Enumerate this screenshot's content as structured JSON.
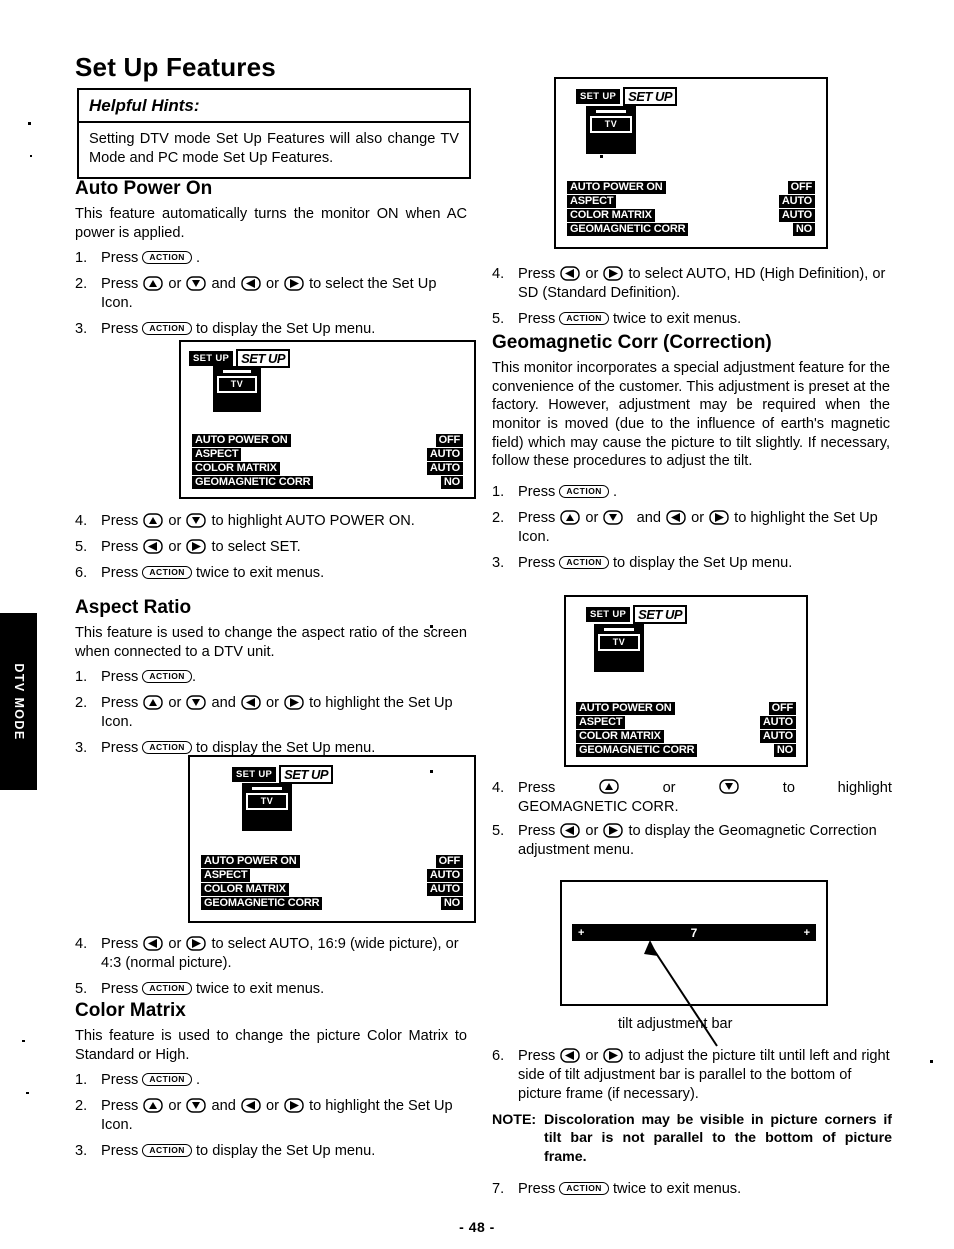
{
  "page": {
    "title": "Set Up Features",
    "number": "- 48 -",
    "side_tab": "DTV MODE"
  },
  "hints": {
    "title": "Helpful Hints:",
    "text": "Setting DTV mode Set Up Features will also change TV Mode and PC mode Set Up Features."
  },
  "keys": {
    "action": "ACTION",
    "up": "up-arrow-key",
    "down": "down-arrow-key",
    "left": "left-arrow-key",
    "right": "right-arrow-key"
  },
  "osd": {
    "setup_small": "SET UP",
    "setup_big": "SET UP",
    "tv": "TV",
    "rows": [
      {
        "label": "AUTO POWER ON",
        "value": "OFF"
      },
      {
        "label": "ASPECT",
        "value": "AUTO"
      },
      {
        "label": "COLOR MATRIX",
        "value": "AUTO"
      },
      {
        "label": "GEOMAGNETIC CORR",
        "value": "NO"
      }
    ]
  },
  "tilt": {
    "minus": "+",
    "value": "7",
    "plus": "+",
    "caption": "tilt adjustment bar"
  },
  "sections": [
    {
      "id": "auto-power-on",
      "heading": "Auto Power On",
      "intro": "This feature automatically turns the monitor ON when AC power is applied.",
      "steps": [
        {
          "num": "1.",
          "parts": [
            "Press ",
            "[ACTION]",
            " ."
          ]
        },
        {
          "num": "2.",
          "parts": [
            "Press ",
            "[UP]",
            " or ",
            "[DOWN]",
            " and ",
            "[LEFT]",
            " or ",
            "[RIGHT]",
            " to select the Set Up Icon."
          ]
        },
        {
          "num": "3.",
          "parts": [
            "Press ",
            "[ACTION]",
            " to display the Set Up menu."
          ]
        },
        {
          "num": "4.",
          "parts": [
            "Press ",
            "[UP]",
            " or ",
            "[DOWN]",
            " to highlight AUTO POWER ON."
          ]
        },
        {
          "num": "5.",
          "parts": [
            "Press ",
            "[LEFT]",
            " or ",
            "[RIGHT]",
            " to select SET."
          ]
        },
        {
          "num": "6.",
          "parts": [
            "Press ",
            "[ACTION]",
            " twice to exit menus."
          ]
        }
      ]
    },
    {
      "id": "aspect-ratio",
      "heading": "Aspect Ratio",
      "intro": "This feature is used to change the aspect ratio of the screen when connected to a DTV unit.",
      "steps": [
        {
          "num": "1.",
          "parts": [
            "Press ",
            "[ACTION]",
            "."
          ]
        },
        {
          "num": "2.",
          "parts": [
            "Press ",
            "[UP]",
            " or ",
            "[DOWN]",
            " and ",
            "[LEFT]",
            " or ",
            "[RIGHT]",
            " to highlight the Set Up Icon."
          ]
        },
        {
          "num": "3.",
          "parts": [
            "Press ",
            "[ACTION]",
            " to display the Set Up menu."
          ]
        },
        {
          "num": "4.",
          "parts": [
            "Press ",
            "[LEFT]",
            " or ",
            "[RIGHT]",
            " to select AUTO, 16:9 (wide picture), or 4:3 (normal picture)."
          ]
        },
        {
          "num": "5.",
          "parts": [
            "Press ",
            "[ACTION]",
            " twice to exit menus."
          ]
        }
      ]
    },
    {
      "id": "color-matrix",
      "heading": "Color Matrix",
      "intro": "This feature is used to change the picture Color Matrix to Standard or High.",
      "steps": [
        {
          "num": "1.",
          "parts": [
            "Press ",
            "[ACTION]",
            " ."
          ]
        },
        {
          "num": "2.",
          "parts": [
            "Press ",
            "[UP]",
            " or ",
            "[DOWN]",
            " and ",
            "[LEFT]",
            " or ",
            "[RIGHT]",
            " to highlight the Set Up Icon."
          ]
        },
        {
          "num": "3.",
          "parts": [
            "Press ",
            "[ACTION]",
            " to display the Set Up menu."
          ]
        },
        {
          "num": "4.",
          "parts": [
            "Press ",
            "[LEFT]",
            " or ",
            "[RIGHT]",
            " to select AUTO, HD (High Definition), or SD (Standard Definition)."
          ]
        },
        {
          "num": "5.",
          "parts": [
            "Press ",
            "[ACTION]",
            " twice to exit menus."
          ]
        }
      ]
    },
    {
      "id": "geomagnetic-corr",
      "heading": "Geomagnetic Corr (Correction)",
      "intro": "This monitor incorporates a special adjustment feature for the convenience of the customer. This adjustment is preset at the factory. However, adjustment may be required when the monitor is moved (due to the influence of earth's magnetic field) which may cause the picture to tilt slightly. If necessary, follow these procedures to adjust the tilt.",
      "steps": [
        {
          "num": "1.",
          "parts": [
            "Press ",
            "[ACTION]",
            " ."
          ]
        },
        {
          "num": "2.",
          "parts": [
            "Press ",
            "[UP]",
            " or ",
            "[DOWN]",
            " and ",
            "[LEFT]",
            " or ",
            "[RIGHT]",
            " to highlight the Set Up Icon."
          ]
        },
        {
          "num": "3.",
          "parts": [
            "Press ",
            "[ACTION]",
            " to display the Set Up menu."
          ]
        },
        {
          "num": "4.",
          "parts": [
            "Press ",
            "[UP]",
            " or ",
            "[DOWN]",
            " to highlight GEOMAGNETIC CORR."
          ]
        },
        {
          "num": "5.",
          "parts": [
            "Press ",
            "[LEFT]",
            " or ",
            "[RIGHT]",
            " to display the Geomagnetic Correction adjustment menu."
          ]
        },
        {
          "num": "6.",
          "parts": [
            "Press ",
            "[LEFT]",
            " or ",
            "[RIGHT]",
            " to adjust the picture tilt until left and right side of tilt adjustment bar is parallel to the bottom of picture frame (if necessary)."
          ]
        },
        {
          "num": "7.",
          "parts": [
            "Press ",
            "[ACTION]",
            " twice to exit menus."
          ]
        }
      ],
      "note_lead": "NOTE:",
      "note_text": "Discoloration may be visible in picture corners if tilt bar is not parallel to the bottom of picture frame."
    }
  ]
}
